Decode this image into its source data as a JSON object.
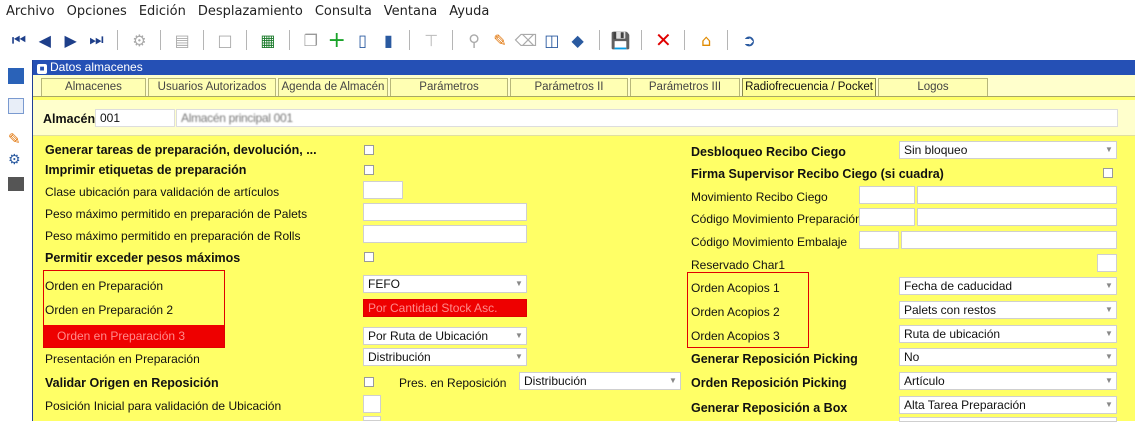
{
  "menu": [
    "Archivo",
    "Opciones",
    "Edición",
    "Desplazamiento",
    "Consulta",
    "Ventana",
    "Ayuda"
  ],
  "window_title": "Datos almacenes",
  "tabs": [
    "Almacenes",
    "Usuarios Autorizados",
    "Agenda de Almacén",
    "Parámetros",
    "Parámetros II",
    "Parámetros III",
    "Radiofrecuencia / Pocket",
    "Logos"
  ],
  "active_tab": "Radiofrecuencia / Pocket",
  "almacen": {
    "label": "Almacén",
    "code": "001",
    "name": "Almacén principal 001"
  },
  "left": {
    "generar_tareas": "Generar tareas de preparación, devolución, ...",
    "imprimir_etiquetas": "Imprimir etiquetas de preparación",
    "clase_ubicacion": "Clase ubicación para validación de artículos",
    "peso_palets": "Peso máximo permitido en preparación de Palets",
    "peso_rolls": "Peso máximo permitido en preparación de Rolls",
    "permitir_exceder": "Permitir exceder pesos máximos",
    "orden_prep": "Orden en Preparación",
    "orden_prep_val": "FEFO",
    "orden_prep2": "Orden en Preparación 2",
    "orden_prep2_val": "Por Cantidad Stock Asc.",
    "orden_prep3": "Orden en Preparación 3",
    "orden_prep3_val": "Por Ruta de Ubicación",
    "presentacion": "Presentación en Preparación",
    "presentacion_val": "Distribución",
    "validar_origen": "Validar Origen en Reposición",
    "pres_reposicion": "Pres. en Reposición",
    "pres_reposicion_val": "Distribución",
    "posicion_inicial": "Posición Inicial para validación de Ubicación"
  },
  "right": {
    "desbloqueo": "Desbloqueo Recibo Ciego",
    "desbloqueo_val": "Sin bloqueo",
    "firma": "Firma Supervisor Recibo Ciego (si cuadra)",
    "movimiento": "Movimiento Recibo Ciego",
    "cod_mov_prep": "Código Movimiento Preparación",
    "cod_mov_emb": "Código Movimiento Embalaje",
    "reservado": "Reservado Char1",
    "orden_acopios1": "Orden Acopios 1",
    "orden_acopios1_val": "Fecha de caducidad",
    "orden_acopios2": "Orden Acopios 2",
    "orden_acopios2_val": "Palets con restos",
    "orden_acopios3": "Orden Acopios 3",
    "orden_acopios3_val": "Ruta de ubicación",
    "gen_repo_picking": "Generar Reposición Picking",
    "gen_repo_picking_val": "No",
    "orden_repo_picking": "Orden Reposición Picking",
    "orden_repo_picking_val": "Artículo",
    "gen_repo_box": "Generar Reposición a Box",
    "gen_repo_box_val": "Alta Tarea Preparación"
  },
  "colors": {
    "form_bg": "#ffff66",
    "titlebar": "#2550b5",
    "highlight": "#ee0000"
  }
}
